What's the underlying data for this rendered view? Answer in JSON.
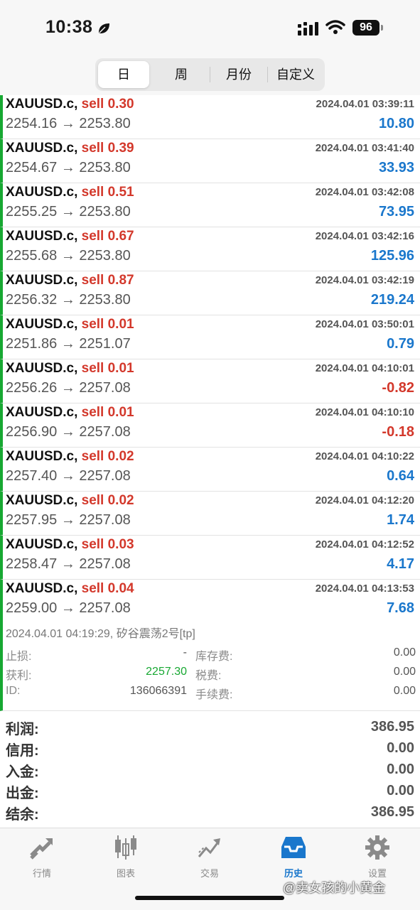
{
  "status_bar": {
    "time": "10:38",
    "battery": "96"
  },
  "segments": [
    {
      "label": "日",
      "active": true
    },
    {
      "label": "周",
      "active": false
    },
    {
      "label": "月份",
      "active": false
    },
    {
      "label": "自定义",
      "active": false
    }
  ],
  "trades": [
    {
      "symbol": "XAUUSD.c,",
      "action": "sell 0.30",
      "time": "2024.04.01 03:39:11",
      "prices": "2254.16 → 2253.80",
      "profit": "10.80",
      "negative": false
    },
    {
      "symbol": "XAUUSD.c,",
      "action": "sell 0.39",
      "time": "2024.04.01 03:41:40",
      "prices": "2254.67 → 2253.80",
      "profit": "33.93",
      "negative": false
    },
    {
      "symbol": "XAUUSD.c,",
      "action": "sell 0.51",
      "time": "2024.04.01 03:42:08",
      "prices": "2255.25 → 2253.80",
      "profit": "73.95",
      "negative": false
    },
    {
      "symbol": "XAUUSD.c,",
      "action": "sell 0.67",
      "time": "2024.04.01 03:42:16",
      "prices": "2255.68 → 2253.80",
      "profit": "125.96",
      "negative": false
    },
    {
      "symbol": "XAUUSD.c,",
      "action": "sell 0.87",
      "time": "2024.04.01 03:42:19",
      "prices": "2256.32 → 2253.80",
      "profit": "219.24",
      "negative": false
    },
    {
      "symbol": "XAUUSD.c,",
      "action": "sell 0.01",
      "time": "2024.04.01 03:50:01",
      "prices": "2251.86 → 2251.07",
      "profit": "0.79",
      "negative": false
    },
    {
      "symbol": "XAUUSD.c,",
      "action": "sell 0.01",
      "time": "2024.04.01 04:10:01",
      "prices": "2256.26 → 2257.08",
      "profit": "-0.82",
      "negative": true
    },
    {
      "symbol": "XAUUSD.c,",
      "action": "sell 0.01",
      "time": "2024.04.01 04:10:10",
      "prices": "2256.90 → 2257.08",
      "profit": "-0.18",
      "negative": true
    },
    {
      "symbol": "XAUUSD.c,",
      "action": "sell 0.02",
      "time": "2024.04.01 04:10:22",
      "prices": "2257.40 → 2257.08",
      "profit": "0.64",
      "negative": false
    },
    {
      "symbol": "XAUUSD.c,",
      "action": "sell 0.02",
      "time": "2024.04.01 04:12:20",
      "prices": "2257.95 → 2257.08",
      "profit": "1.74",
      "negative": false
    },
    {
      "symbol": "XAUUSD.c,",
      "action": "sell 0.03",
      "time": "2024.04.01 04:12:52",
      "prices": "2258.47 → 2257.08",
      "profit": "4.17",
      "negative": false
    },
    {
      "symbol": "XAUUSD.c,",
      "action": "sell 0.04",
      "time": "2024.04.01 04:13:53",
      "prices": "2259.00 → 2257.08",
      "profit": "7.68",
      "negative": false
    }
  ],
  "details": {
    "header": "2024.04.01 04:19:29, 矽谷震荡2号[tp]",
    "stop_loss_label": "止损:",
    "stop_loss_value": "-",
    "storage_label": "库存费:",
    "storage_value": "0.00",
    "take_profit_label": "获利:",
    "take_profit_value": "2257.30",
    "tax_label": "税费:",
    "tax_value": "0.00",
    "id_label": "ID:",
    "id_value": "136066391",
    "commission_label": "手续费:",
    "commission_value": "0.00"
  },
  "summary": [
    {
      "label": "利润:",
      "value": "386.95"
    },
    {
      "label": "信用:",
      "value": "0.00"
    },
    {
      "label": "入金:",
      "value": "0.00"
    },
    {
      "label": "出金:",
      "value": "0.00"
    },
    {
      "label": "结余:",
      "value": "386.95"
    }
  ],
  "tabs": [
    {
      "label": "行情",
      "icon": "quotes-arrow-icon",
      "active": false
    },
    {
      "label": "图表",
      "icon": "candlestick-icon",
      "active": false
    },
    {
      "label": "交易",
      "icon": "trade-line-icon",
      "active": false
    },
    {
      "label": "历史",
      "icon": "history-inbox-icon",
      "active": true
    },
    {
      "label": "设置",
      "icon": "gear-icon",
      "active": false
    }
  ],
  "watermark": "@卖女孩的小黄金",
  "colors": {
    "accent_blue": "#1a77cc",
    "sell_red": "#d3382b",
    "profit_green": "#17a832"
  }
}
